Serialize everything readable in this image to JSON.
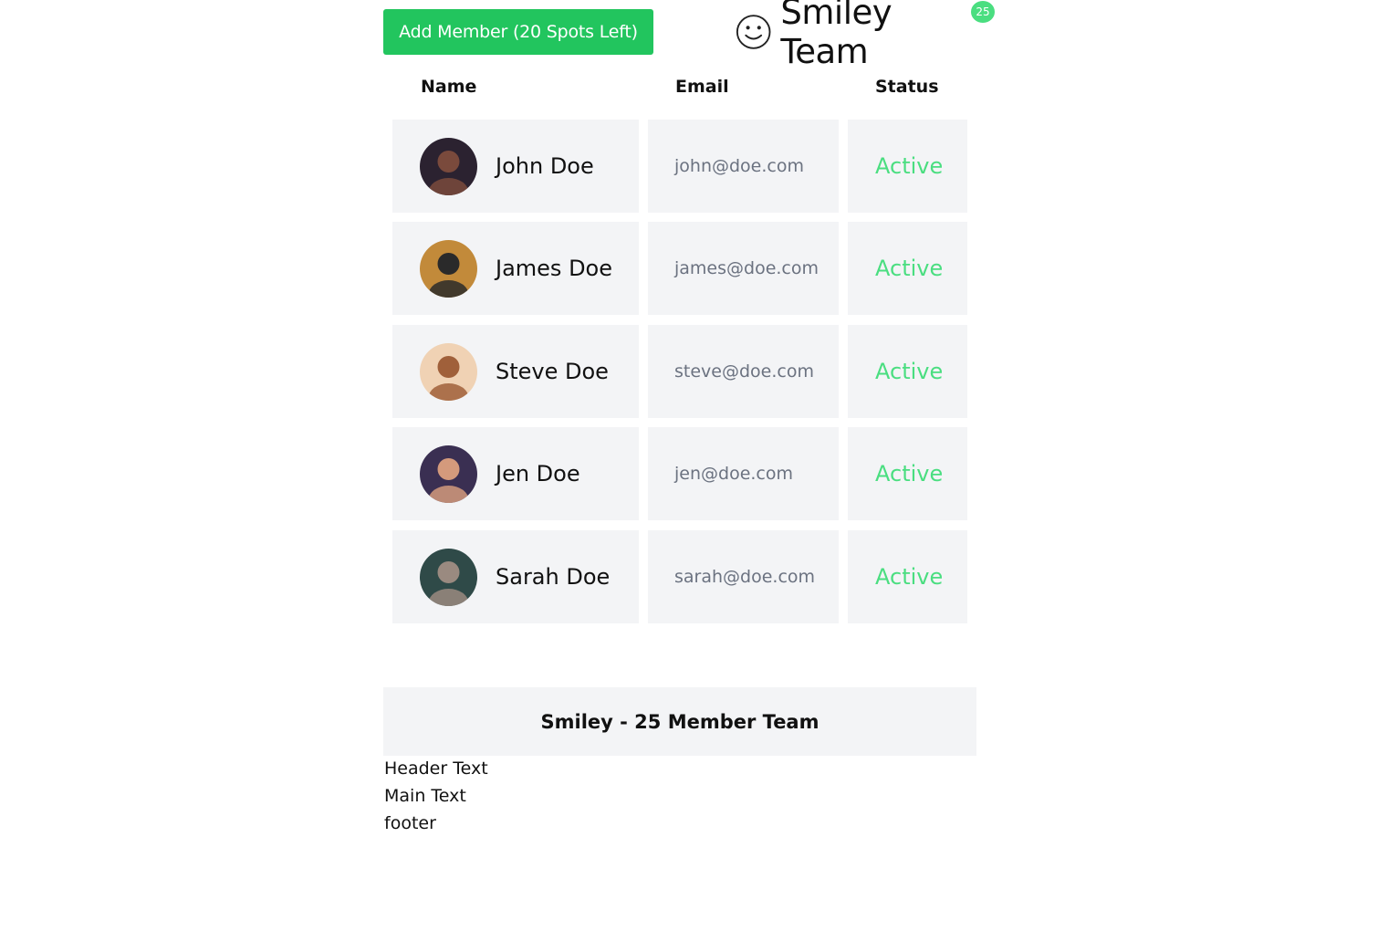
{
  "toolbar": {
    "add_member_label": "Add Member (20 Spots Left)"
  },
  "brand": {
    "icon": "smiley-icon",
    "title": "Smiley Team",
    "badge_count": "25"
  },
  "table": {
    "headers": {
      "name": "Name",
      "email": "Email",
      "status": "Status"
    },
    "rows": [
      {
        "name": "John Doe",
        "email": "john@doe.com",
        "status": "Active",
        "avatar_colors": [
          "#2b2230",
          "#7a4a3c"
        ]
      },
      {
        "name": "James Doe",
        "email": "james@doe.com",
        "status": "Active",
        "avatar_colors": [
          "#c28a3a",
          "#2a2a2a"
        ]
      },
      {
        "name": "Steve Doe",
        "email": "steve@doe.com",
        "status": "Active",
        "avatar_colors": [
          "#f0d2b4",
          "#a0603a"
        ]
      },
      {
        "name": "Jen Doe",
        "email": "jen@doe.com",
        "status": "Active",
        "avatar_colors": [
          "#3a2f52",
          "#d49a7c"
        ]
      },
      {
        "name": "Sarah Doe",
        "email": "sarah@doe.com",
        "status": "Active",
        "avatar_colors": [
          "#2f4a48",
          "#9a8a80"
        ]
      }
    ]
  },
  "summary": {
    "title": "Smiley - 25 Member Team"
  },
  "footer_texts": {
    "header": "Header Text",
    "main": "Main Text",
    "footer": "footer"
  },
  "colors": {
    "accent": "#22c55e",
    "status_active": "#4ade80",
    "cell_bg": "#f3f4f6",
    "email_text": "#6b7280"
  }
}
